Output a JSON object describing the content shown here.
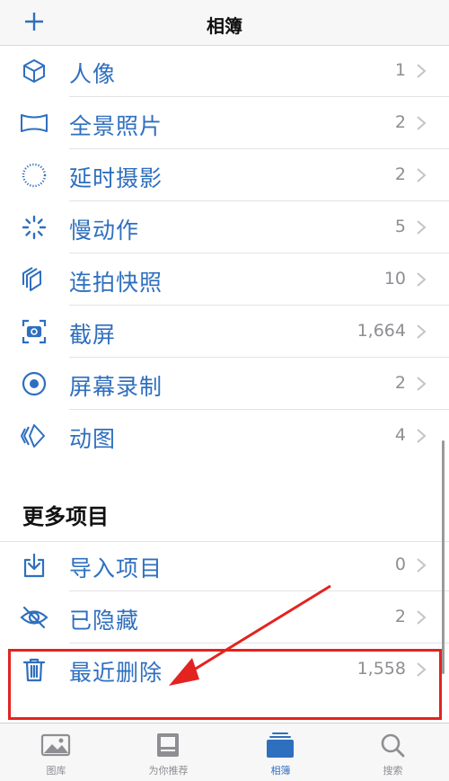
{
  "navbar": {
    "title": "相簿",
    "add_icon": "plus-icon"
  },
  "media_types": [
    {
      "label": "人像",
      "count": "1",
      "icon": "cube-icon"
    },
    {
      "label": "全景照片",
      "count": "2",
      "icon": "panorama-icon"
    },
    {
      "label": "延时摄影",
      "count": "2",
      "icon": "timelapse-icon"
    },
    {
      "label": "慢动作",
      "count": "5",
      "icon": "slowmo-icon"
    },
    {
      "label": "连拍快照",
      "count": "10",
      "icon": "burst-icon"
    },
    {
      "label": "截屏",
      "count": "1,664",
      "icon": "screenshot-icon"
    },
    {
      "label": "屏幕录制",
      "count": "2",
      "icon": "screen-record-icon"
    },
    {
      "label": "动图",
      "count": "4",
      "icon": "animated-icon"
    }
  ],
  "more_section": {
    "title": "更多项目",
    "items": [
      {
        "label": "导入项目",
        "count": "0",
        "icon": "import-icon"
      },
      {
        "label": "已隐藏",
        "count": "2",
        "icon": "eye-slash-icon"
      },
      {
        "label": "最近删除",
        "count": "1,558",
        "icon": "trash-icon"
      }
    ]
  },
  "tabbar": {
    "tabs": [
      {
        "label": "图库",
        "icon": "photos-icon",
        "active": false
      },
      {
        "label": "为你推荐",
        "icon": "for-you-icon",
        "active": false
      },
      {
        "label": "相簿",
        "icon": "albums-icon",
        "active": true
      },
      {
        "label": "搜索",
        "icon": "search-icon",
        "active": false
      }
    ]
  },
  "colors": {
    "accent": "#2f6fbf",
    "count_gray": "#8e8e93",
    "annotation_red": "#e3231f"
  }
}
